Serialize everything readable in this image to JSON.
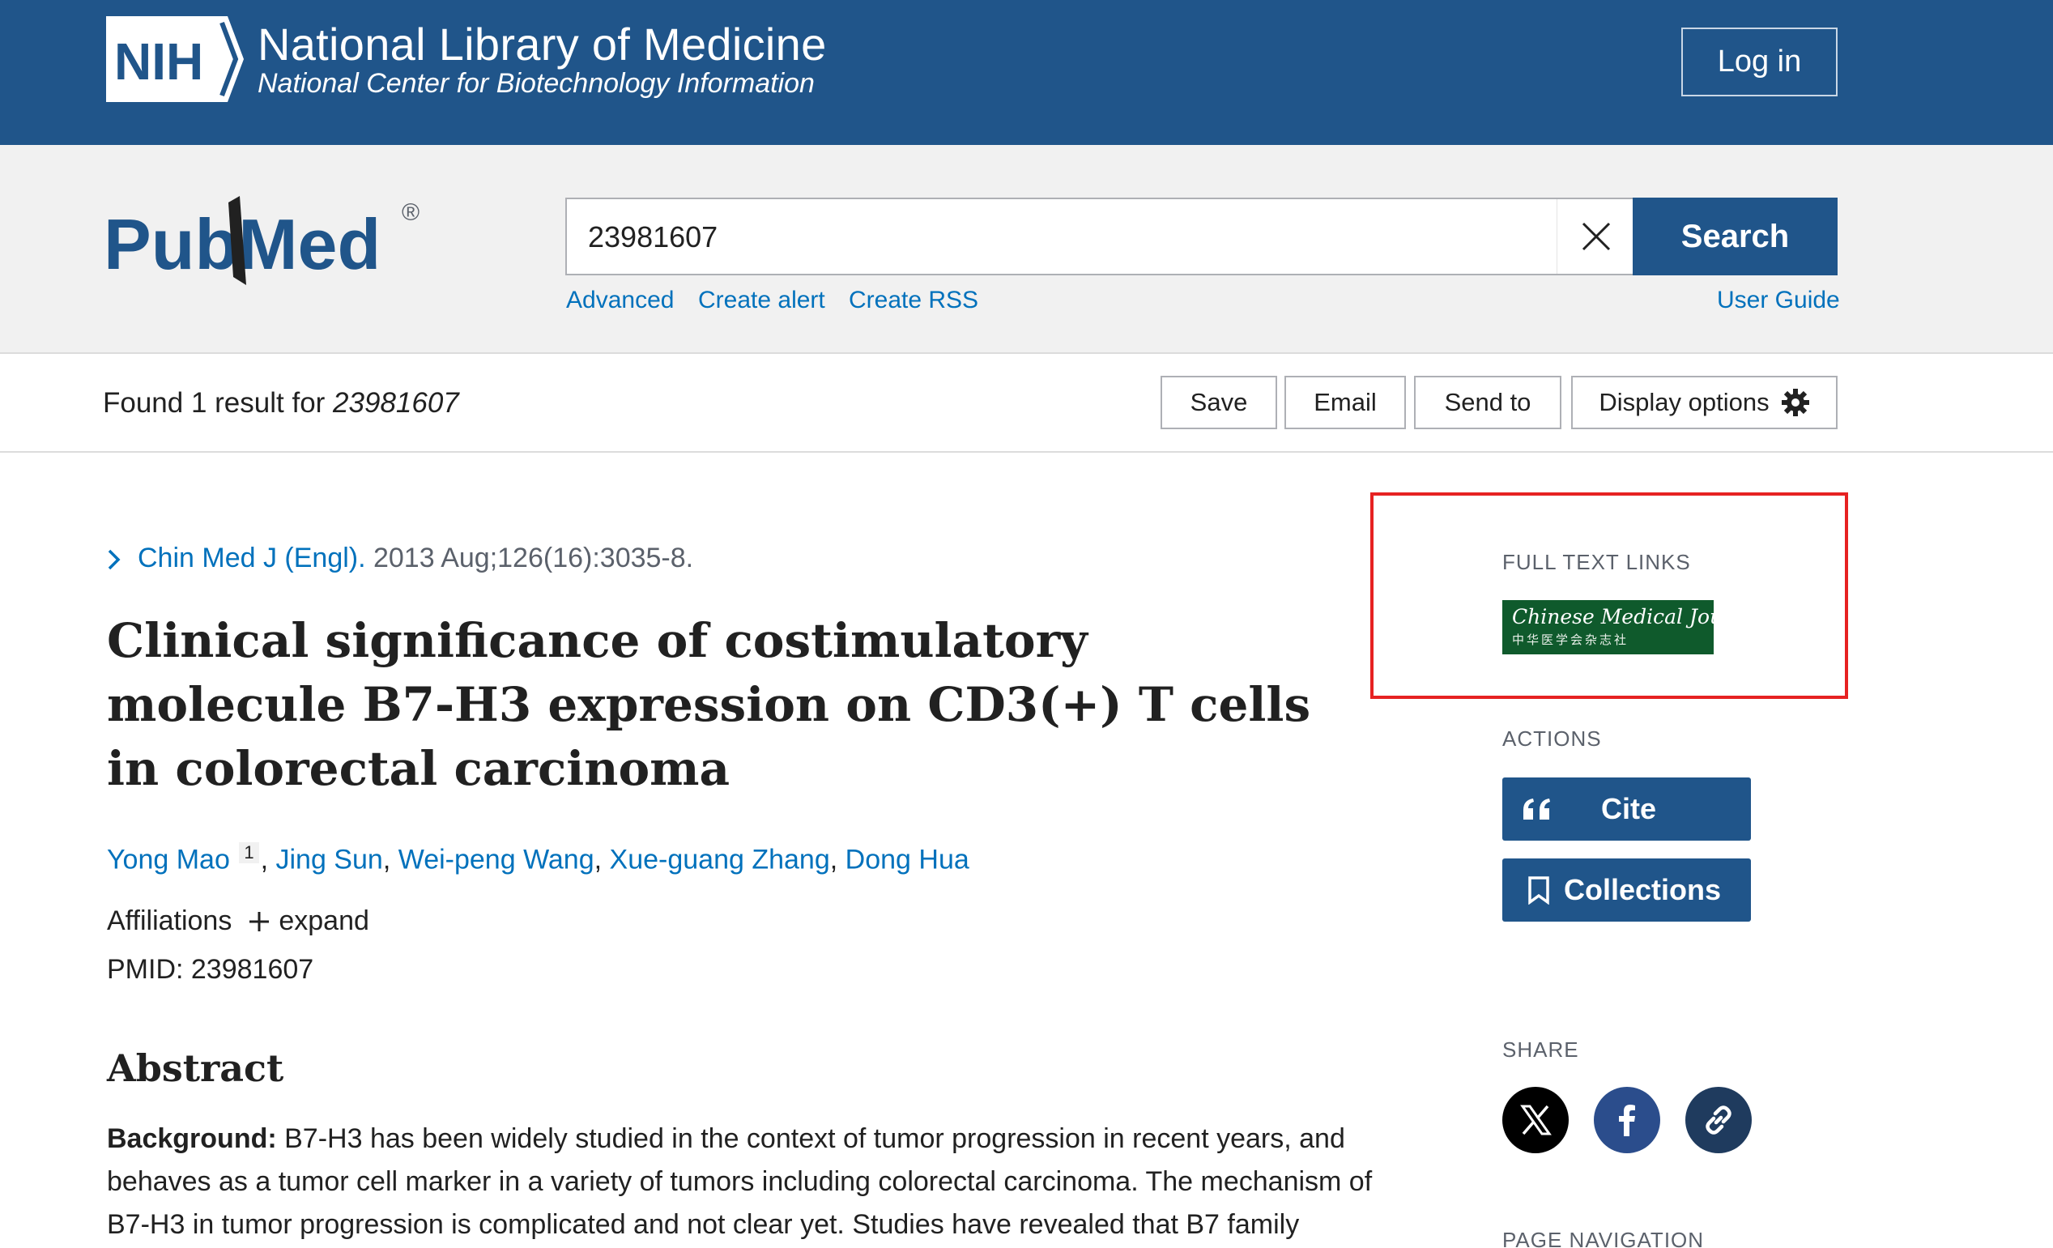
{
  "nih": {
    "logo_text": "NIH",
    "title": "National Library of Medicine",
    "subtitle": "National Center for Biotechnology Information",
    "login_label": "Log in"
  },
  "pubmed": {
    "logo_text": "PubMed",
    "search_value": "23981607",
    "search_button": "Search",
    "links": {
      "advanced": "Advanced",
      "create_alert": "Create alert",
      "create_rss": "Create RSS",
      "user_guide": "User Guide"
    }
  },
  "results": {
    "found_prefix": "Found 1 result for ",
    "query": "23981607",
    "buttons": {
      "save": "Save",
      "email": "Email",
      "send_to": "Send to",
      "display_options": "Display options"
    }
  },
  "article": {
    "journal": "Chin Med J (Engl).",
    "citation": " 2013 Aug;126(16):3035-8.",
    "title": "Clinical significance of costimulatory molecule B7-H3 expression on CD3(+) T cells in colorectal carcinoma",
    "authors": [
      {
        "name": "Yong Mao",
        "sup": "1"
      },
      {
        "name": "Jing Sun"
      },
      {
        "name": "Wei-peng Wang"
      },
      {
        "name": "Xue-guang Zhang"
      },
      {
        "name": "Dong Hua"
      }
    ],
    "affiliations_label": "Affiliations",
    "expand_label": "expand",
    "pmid": "PMID: 23981607",
    "abstract_heading": "Abstract",
    "abstract_bold": "Background:",
    "abstract_text": " B7-H3 has been widely studied in the context of tumor progression in recent years, and behaves as a tumor cell marker in a variety of tumors including colorectal carcinoma. The mechanism of B7-H3 in tumor progression is complicated and not clear yet. Studies have revealed that B7 family"
  },
  "sidebar": {
    "full_text_label": "FULL TEXT LINKS",
    "cmj_logo_text": "Chinese Medical Journal",
    "cmj_logo_sub": "中华医学会杂志社",
    "actions_label": "ACTIONS",
    "cite_label": "Cite",
    "collections_label": "Collections",
    "share_label": "SHARE",
    "page_nav_label": "PAGE NAVIGATION"
  },
  "colors": {
    "nih_blue": "#20558a",
    "link_blue": "#0071bc",
    "highlight_red": "#e62222",
    "cmj_green": "#0f5a2c",
    "facebook_blue": "#2b4d8c",
    "permalink_navy": "#1f3b5e"
  },
  "icons": [
    "nih-logo",
    "pubmed-logo",
    "close-icon",
    "gear-icon",
    "chevron-right-icon",
    "plus-icon",
    "quote-icon",
    "bookmark-icon",
    "x-twitter-icon",
    "facebook-icon",
    "link-icon"
  ]
}
